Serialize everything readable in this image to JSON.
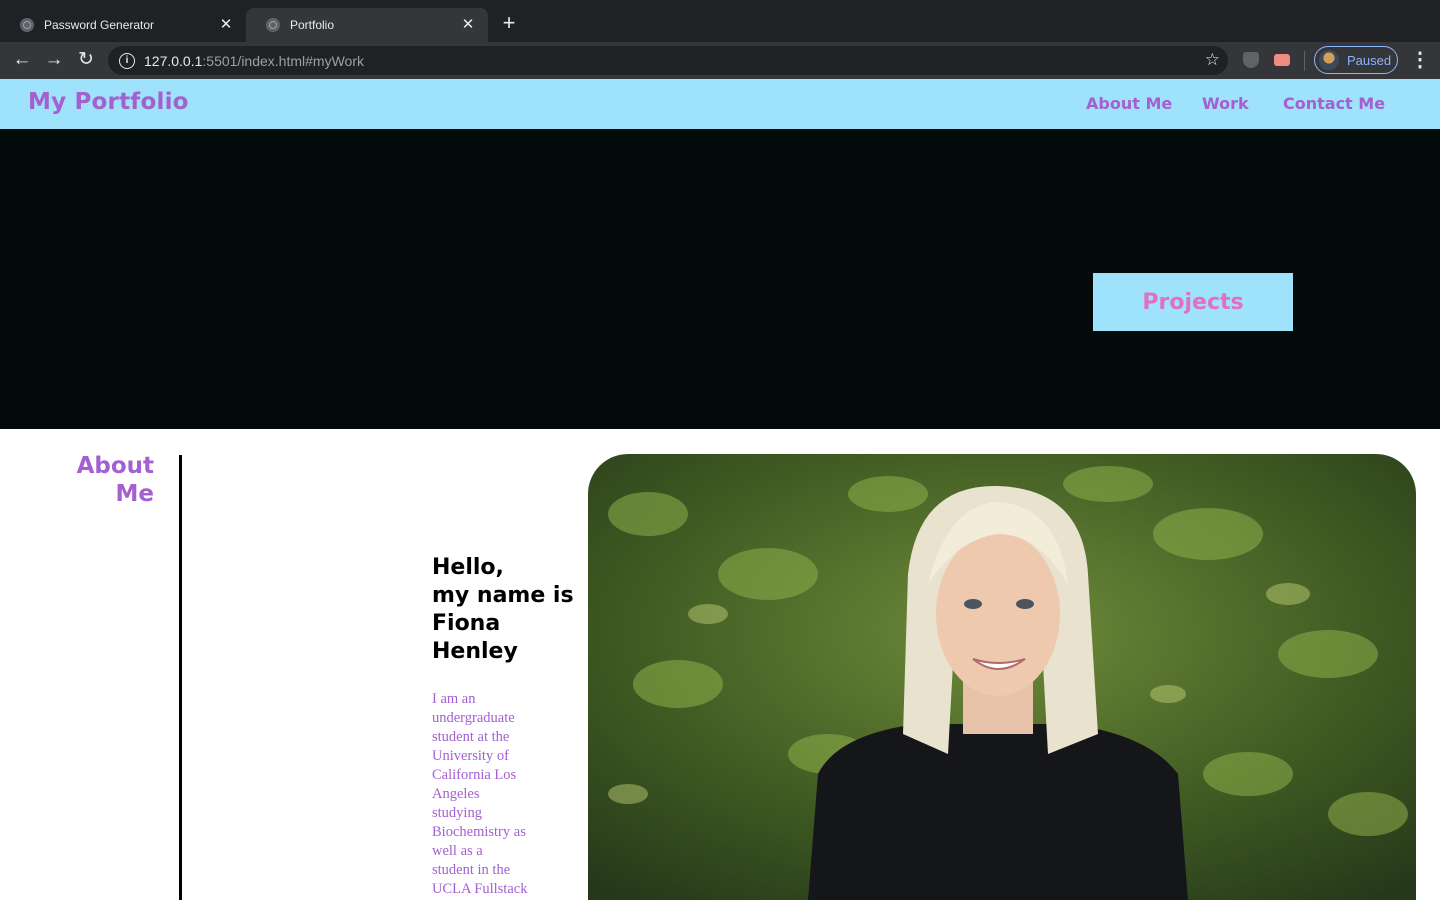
{
  "browser": {
    "tabs": [
      {
        "title": "Password Generator",
        "active": false
      },
      {
        "title": "Portfolio",
        "active": true
      }
    ],
    "new_tab_icon": "plus-icon",
    "url_host": "127.0.0.1",
    "url_rest": ":5501/index.html#myWork",
    "profile_status": "Paused"
  },
  "site": {
    "brand": "My Portfolio",
    "nav": [
      "About Me",
      "Work",
      "Contact Me"
    ],
    "hero_button": "Projects",
    "about_heading_line1": "About",
    "about_heading_line2": "Me",
    "greeting": [
      "Hello,",
      "my name is",
      "Fiona",
      "Henley"
    ],
    "bio": [
      "I am an",
      "undergraduate",
      "student at the",
      "University of",
      "California Los",
      "Angeles",
      "studying",
      "Biochemistry as",
      "well as a",
      "student in the",
      "UCLA Fullstack"
    ]
  },
  "colors": {
    "header_bg": "#9fe2fb",
    "brand_purple": "#a45fd1",
    "hero_bg": "#020b09",
    "projects_pink": "#e26fc0"
  }
}
